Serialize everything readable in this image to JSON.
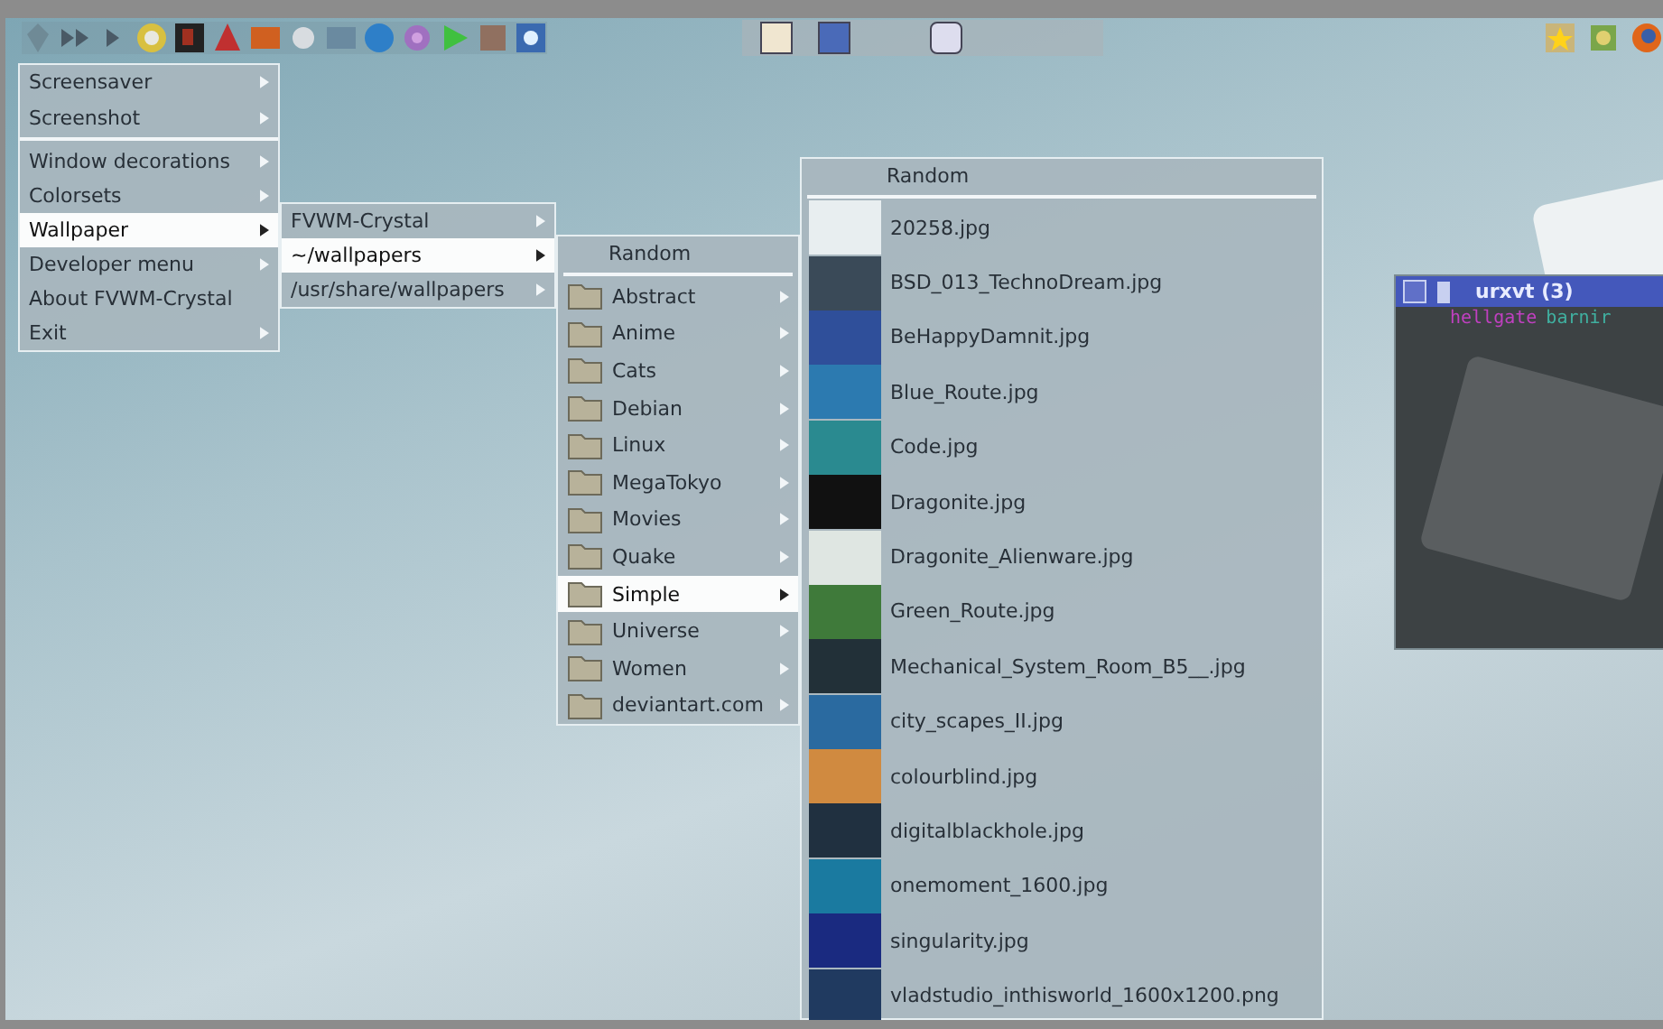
{
  "menus": [
    {
      "items": [
        {
          "label": "Screensaver",
          "submenu": true,
          "selected": false,
          "separator_after": false
        },
        {
          "label": "Screenshot",
          "submenu": true,
          "selected": false,
          "separator_after": true
        },
        {
          "label": "Window decorations",
          "submenu": true,
          "selected": false,
          "separator_after": false
        },
        {
          "label": "Colorsets",
          "submenu": true,
          "selected": false,
          "separator_after": false
        },
        {
          "label": "Wallpaper",
          "submenu": true,
          "selected": true,
          "separator_after": false
        },
        {
          "label": "Developer menu",
          "submenu": true,
          "selected": false,
          "separator_after": false
        },
        {
          "label": "About FVWM-Crystal",
          "submenu": false,
          "selected": false,
          "separator_after": false
        },
        {
          "label": "Exit",
          "submenu": true,
          "selected": false,
          "separator_after": false
        }
      ]
    },
    {
      "items": [
        {
          "label": "FVWM-Crystal",
          "submenu": true,
          "selected": false,
          "separator_after": false
        },
        {
          "label": "~/wallpapers",
          "submenu": true,
          "selected": true,
          "separator_after": false
        },
        {
          "label": "/usr/share/wallpapers",
          "submenu": true,
          "selected": false,
          "separator_after": false
        }
      ]
    },
    {
      "title": "Random",
      "items": [
        {
          "label": "Abstract",
          "kind": "folder",
          "submenu": true,
          "selected": false
        },
        {
          "label": "Anime",
          "kind": "folder",
          "submenu": true,
          "selected": false
        },
        {
          "label": "Cats",
          "kind": "folder",
          "submenu": true,
          "selected": false
        },
        {
          "label": "Debian",
          "kind": "folder",
          "submenu": true,
          "selected": false
        },
        {
          "label": "Linux",
          "kind": "folder",
          "submenu": true,
          "selected": false
        },
        {
          "label": "MegaTokyo",
          "kind": "folder",
          "submenu": true,
          "selected": false
        },
        {
          "label": "Movies",
          "kind": "folder",
          "submenu": true,
          "selected": false
        },
        {
          "label": "Quake",
          "kind": "folder",
          "submenu": true,
          "selected": false
        },
        {
          "label": "Simple",
          "kind": "folder",
          "submenu": true,
          "selected": true
        },
        {
          "label": "Universe",
          "kind": "folder",
          "submenu": true,
          "selected": false
        },
        {
          "label": "Women",
          "kind": "folder",
          "submenu": true,
          "selected": false
        },
        {
          "label": "deviantart.com",
          "kind": "folder",
          "submenu": true,
          "selected": false
        }
      ]
    },
    {
      "title": "Random",
      "items": [
        {
          "label": "20258.jpg",
          "kind": "image",
          "submenu": false,
          "selected": false
        },
        {
          "label": "BSD_013_TechnoDream.jpg",
          "kind": "image",
          "submenu": false,
          "selected": false
        },
        {
          "label": "BeHappyDamnit.jpg",
          "kind": "image",
          "submenu": false,
          "selected": false
        },
        {
          "label": "Blue_Route.jpg",
          "kind": "image",
          "submenu": false,
          "selected": false
        },
        {
          "label": "Code.jpg",
          "kind": "image",
          "submenu": false,
          "selected": false
        },
        {
          "label": "Dragonite.jpg",
          "kind": "image",
          "submenu": false,
          "selected": false
        },
        {
          "label": "Dragonite_Alienware.jpg",
          "kind": "image",
          "submenu": false,
          "selected": false
        },
        {
          "label": "Green_Route.jpg",
          "kind": "image",
          "submenu": false,
          "selected": false
        },
        {
          "label": "Mechanical_System_Room_B5__.jpg",
          "kind": "image",
          "submenu": false,
          "selected": false
        },
        {
          "label": "city_scapes_II.jpg",
          "kind": "image",
          "submenu": false,
          "selected": false
        },
        {
          "label": "colourblind.jpg",
          "kind": "image",
          "submenu": false,
          "selected": false
        },
        {
          "label": "digitalblackhole.jpg",
          "kind": "image",
          "submenu": false,
          "selected": false
        },
        {
          "label": "onemoment_1600.jpg",
          "kind": "image",
          "submenu": false,
          "selected": false
        },
        {
          "label": "singularity.jpg",
          "kind": "image",
          "submenu": false,
          "selected": false
        },
        {
          "label": "vladstudio_inthisworld_1600x1200.png",
          "kind": "image",
          "submenu": false,
          "selected": false
        }
      ]
    }
  ],
  "terminal": {
    "title": "urxvt (3)",
    "user": "hellgate",
    "host": "barnir"
  }
}
